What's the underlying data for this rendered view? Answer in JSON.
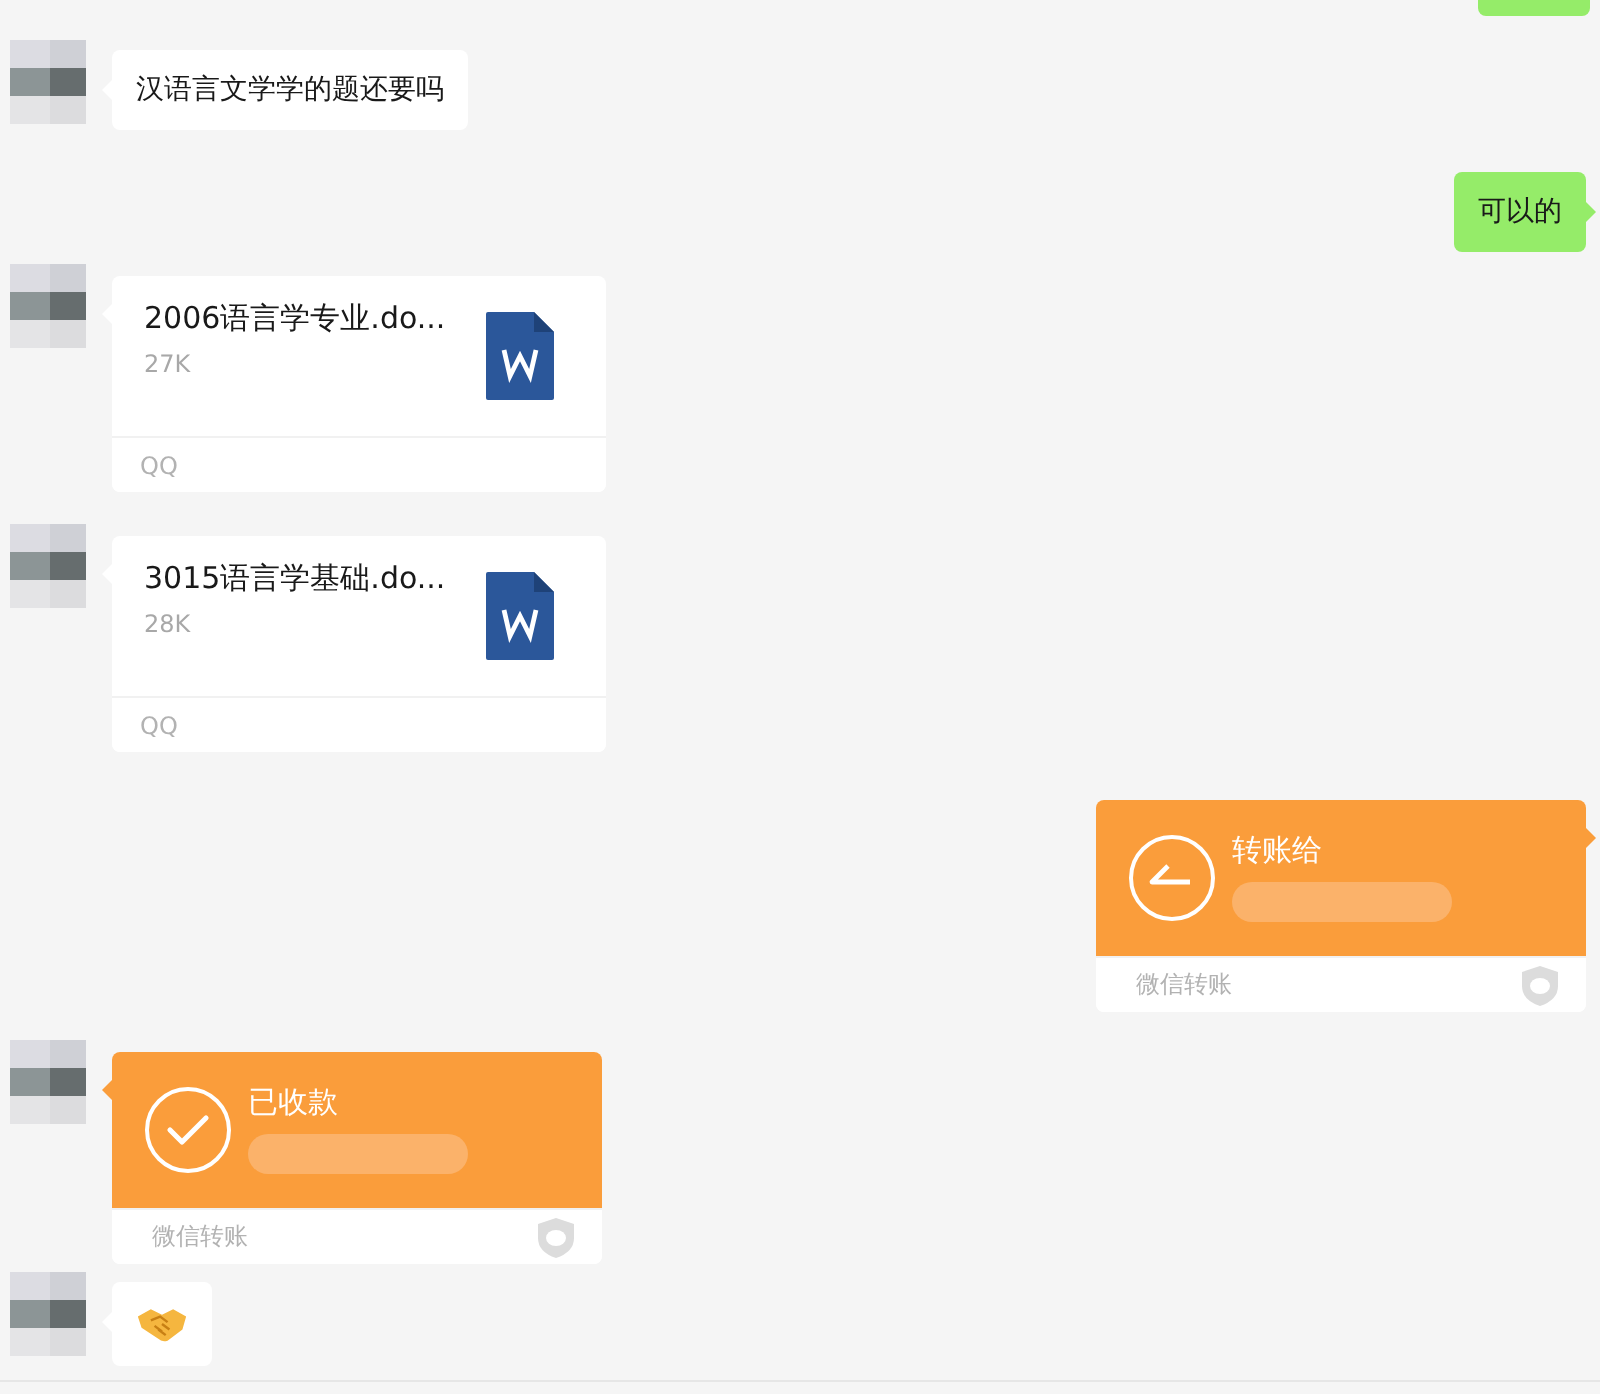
{
  "messages": [
    {
      "kind": "cut",
      "outgoing": true
    },
    {
      "kind": "text",
      "outgoing": false,
      "text": "汉语言文学学的题还要吗"
    },
    {
      "kind": "text",
      "outgoing": true,
      "text": "可以的"
    },
    {
      "kind": "file",
      "name": "2006语言学专业.do...",
      "size": "27K",
      "source": "QQ"
    },
    {
      "kind": "file",
      "name": "3015语言学基础.do...",
      "size": "28K",
      "source": "QQ"
    },
    {
      "kind": "transfer-sent",
      "outgoing": true,
      "title": "转账给",
      "footer": "微信转账"
    },
    {
      "kind": "transfer-received",
      "outgoing": false,
      "title": "已收款",
      "footer": "微信转账"
    },
    {
      "kind": "emoji",
      "outgoing": false
    }
  ]
}
